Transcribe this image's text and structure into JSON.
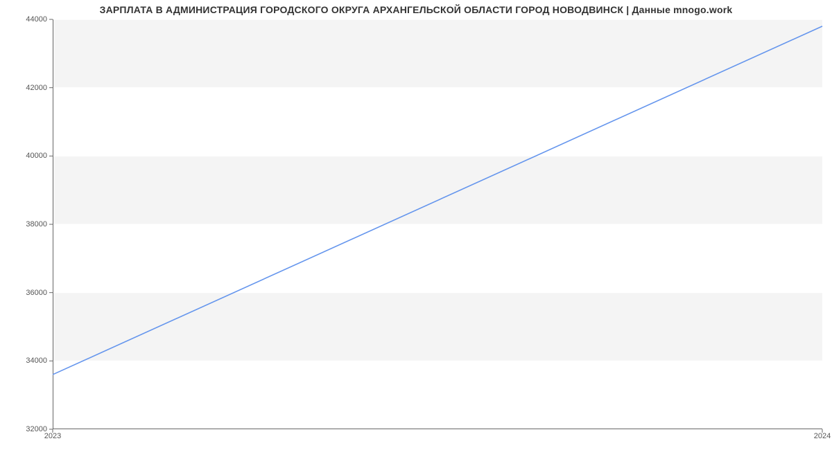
{
  "chart_data": {
    "type": "line",
    "title": "ЗАРПЛАТА В АДМИНИСТРАЦИЯ ГОРОДСКОГО ОКРУГА АРХАНГЕЛЬСКОЙ ОБЛАСТИ ГОРОД НОВОДВИНСК | Данные mnogo.work",
    "x": [
      2023,
      2024
    ],
    "values": [
      33600,
      43800
    ],
    "xlabel": "",
    "ylabel": "",
    "xlim": [
      2023,
      2024
    ],
    "ylim": [
      32000,
      44000
    ],
    "x_ticks": [
      2023,
      2024
    ],
    "y_ticks": [
      32000,
      34000,
      36000,
      38000,
      40000,
      42000,
      44000
    ],
    "line_color": "#6495ed",
    "band_color": "#f4f4f4",
    "grid_color": "#ffffff"
  }
}
